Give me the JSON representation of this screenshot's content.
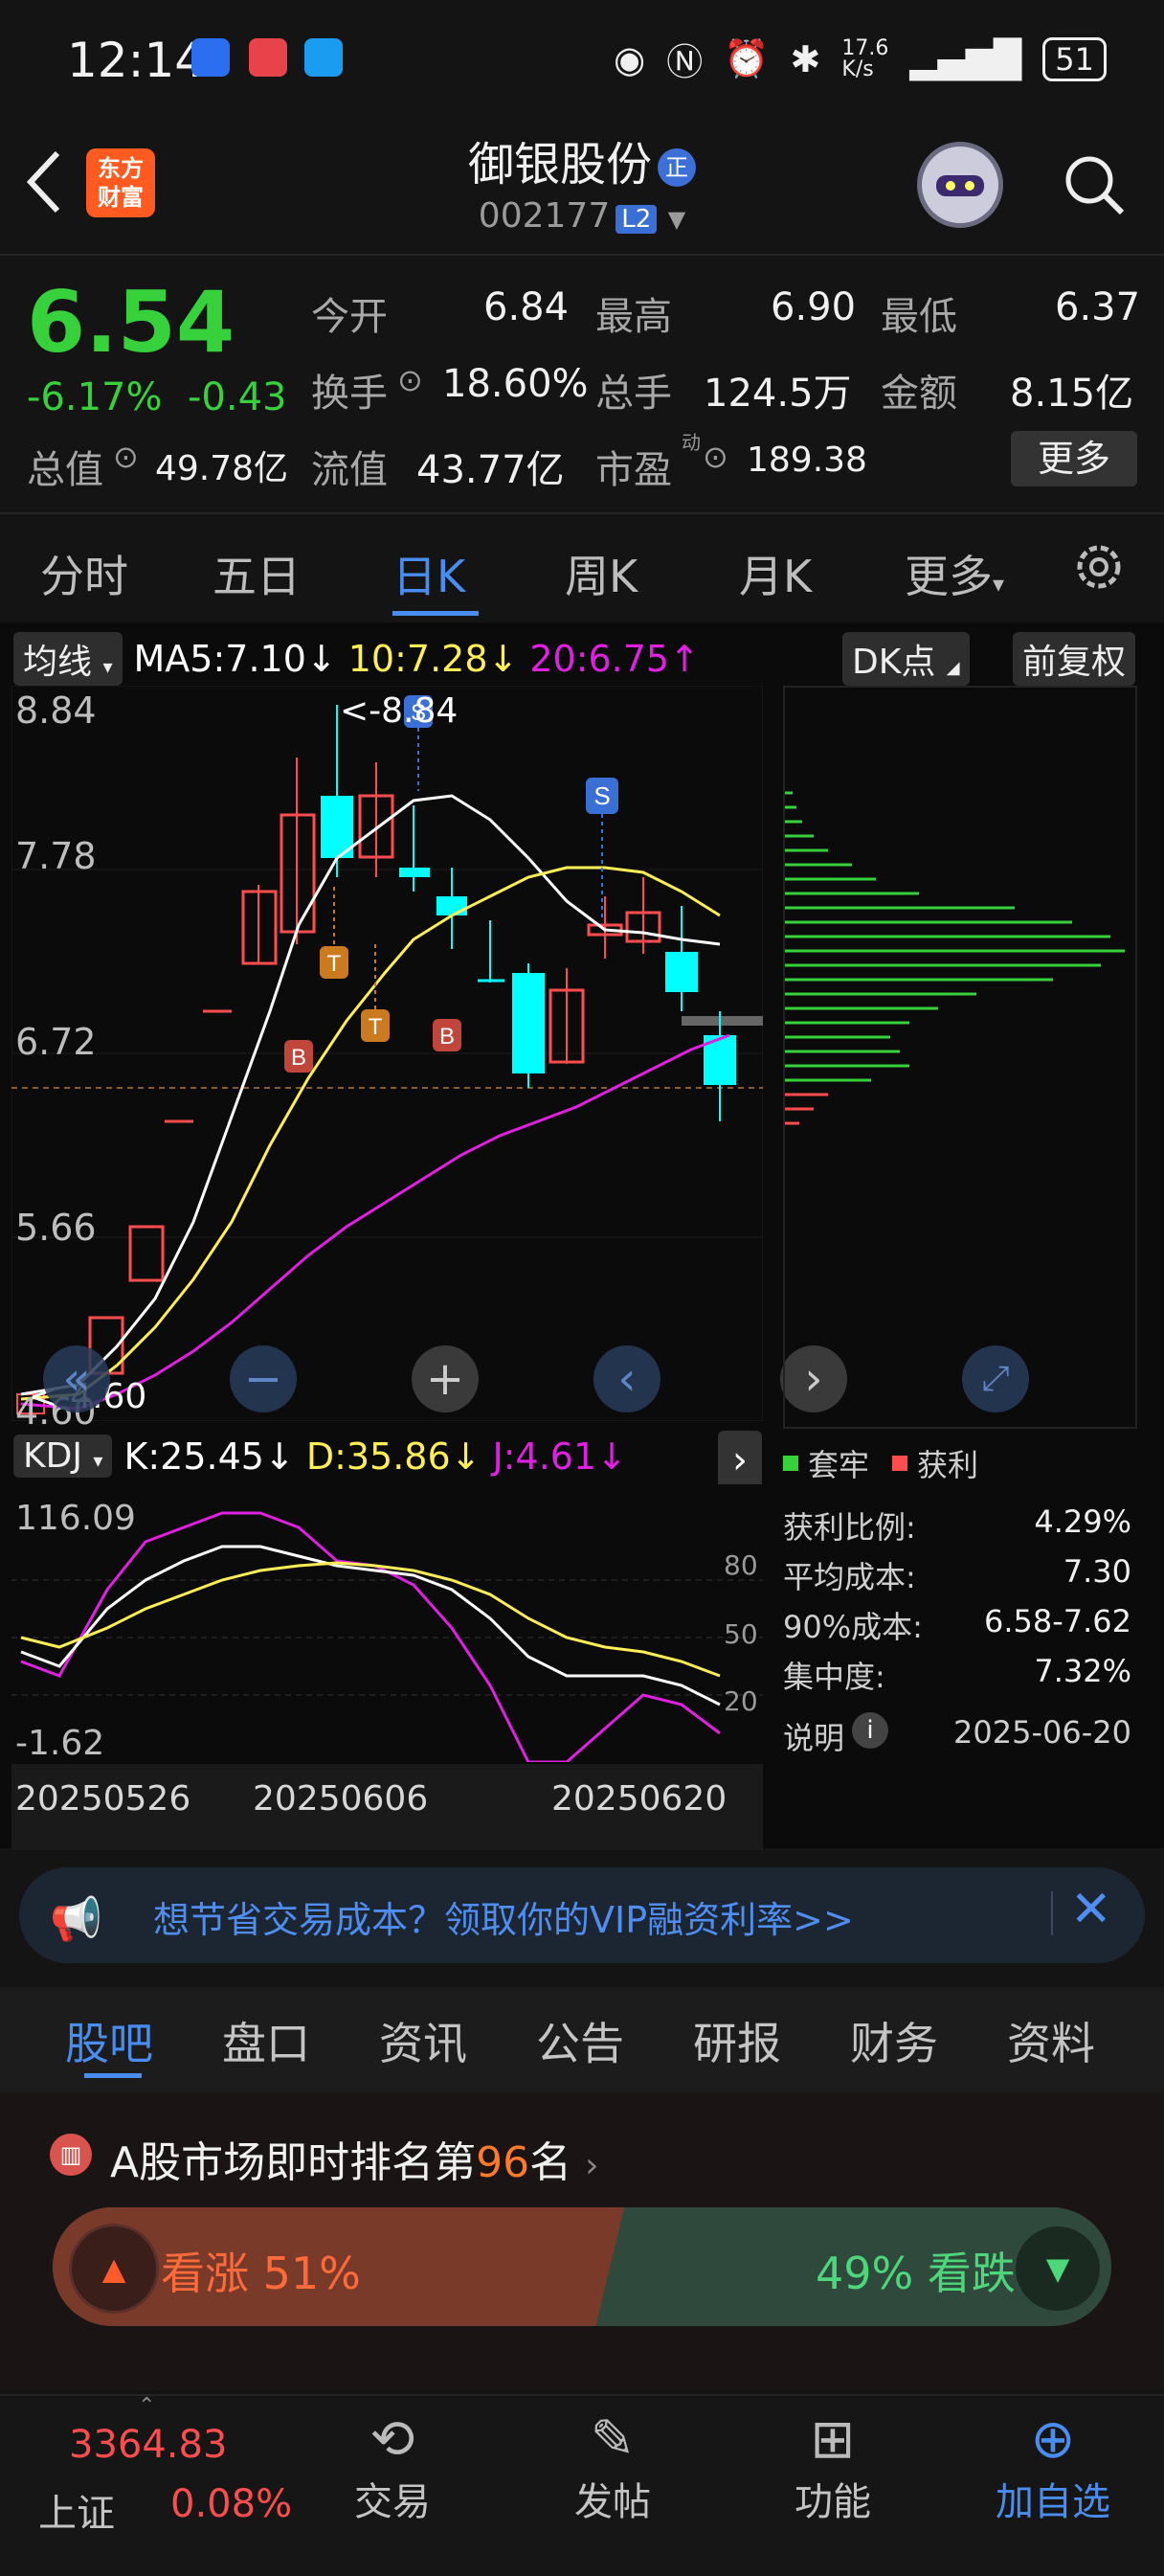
{
  "status_bar": {
    "time": "12:14",
    "speed": "17.6\nK/s",
    "battery": "51"
  },
  "header": {
    "stock_name": "御银股份",
    "badge": "正",
    "stock_code": "002177",
    "level": "L2",
    "logo_text_1": "东方",
    "logo_text_2": "财富"
  },
  "quote": {
    "price": "6.54",
    "change_pct": "-6.17%",
    "change_abs": "-0.43",
    "open_label": "今开",
    "open": "6.84",
    "high_label": "最高",
    "high": "6.90",
    "low_label": "最低",
    "low": "6.37",
    "turnover_label": "换手",
    "turnover": "18.60%",
    "volume_label": "总手",
    "volume": "124.5万",
    "amount_label": "金额",
    "amount": "8.15亿",
    "mktcap_label": "总值",
    "mktcap": "49.78亿",
    "float_label": "流值",
    "float": "43.77亿",
    "pe_label": "市盈",
    "pe_sup": "动",
    "pe": "189.38",
    "more": "更多"
  },
  "tabs": [
    "分时",
    "五日",
    "日K",
    "周K",
    "月K",
    "更多"
  ],
  "active_tab": "日K",
  "ma_bar": {
    "selector": "均线",
    "ma5": "MA5:7.10↓",
    "ma10": "10:7.28↓",
    "ma20": "20:6.75↑",
    "dk": "DK点",
    "fq": "前复权"
  },
  "price_axis": [
    "8.84",
    "7.78",
    "6.72",
    "5.66",
    "4.60"
  ],
  "annotations": {
    "high_mark": "<-8.84",
    "low_mark": "<-4.60"
  },
  "kdj_bar": {
    "selector": "KDJ",
    "k": "K:25.45↓",
    "d": "D:35.86↓",
    "j": "J:4.61↓"
  },
  "kdj_axis": {
    "top": "116.09",
    "bottom": "-1.62",
    "l80": "80",
    "l50": "50",
    "l20": "20"
  },
  "dates": [
    "20250526",
    "20250606",
    "20250620"
  ],
  "cost_legend": {
    "hold": "套牢",
    "profit": "获利"
  },
  "cost_stats": [
    {
      "label": "获利比例:",
      "value": "4.29%"
    },
    {
      "label": "平均成本:",
      "value": "7.30"
    },
    {
      "label": "90%成本:",
      "value": "6.58-7.62"
    },
    {
      "label": "集中度:",
      "value": "7.32%"
    }
  ],
  "cost_note": {
    "label": "说明",
    "date": "2025-06-20"
  },
  "banner": {
    "text": "想节省交易成本？领取你的VIP融资利率>>"
  },
  "bottom_tabs": [
    "股吧",
    "盘口",
    "资讯",
    "公告",
    "研报",
    "财务",
    "资料"
  ],
  "active_bottom_tab": "股吧",
  "rank": {
    "prefix": "A股市场即时排名第",
    "number": "96",
    "suffix": "名"
  },
  "vote": {
    "up_label": "看涨 51%",
    "down_label": "49% 看跌",
    "up_pct": 51,
    "down_pct": 49
  },
  "bottom_nav": {
    "index_value": "3364.83",
    "index_name": "上证",
    "index_change": "0.08%",
    "items": [
      "交易",
      "发帖",
      "功能",
      "加自选"
    ]
  },
  "colors": {
    "up": "#ff4d4f",
    "down": "#36d13b",
    "accent": "#4a8df0",
    "ma5": "#ffffff",
    "ma10": "#ffee55",
    "ma20": "#e020e0",
    "kline_down": "#00ffff"
  }
}
